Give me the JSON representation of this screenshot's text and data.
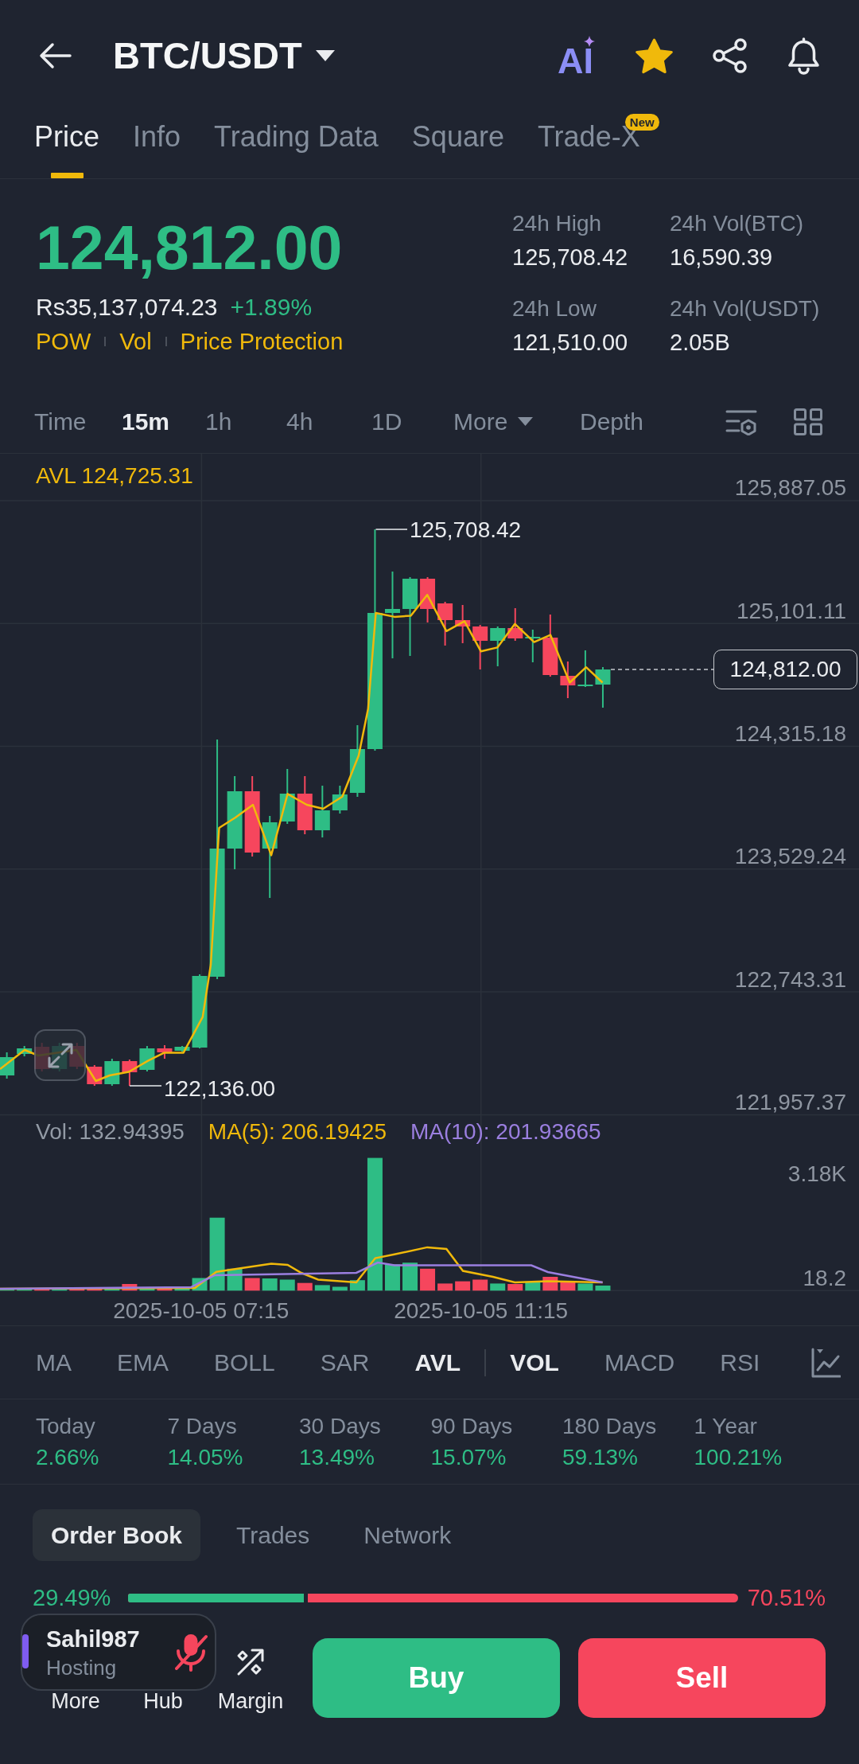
{
  "header": {
    "pair": "BTC/USDT",
    "ai_label": "AI",
    "favorite": true
  },
  "tabs": [
    {
      "label": "Price",
      "selected": true
    },
    {
      "label": "Info",
      "selected": false
    },
    {
      "label": "Trading Data",
      "selected": false
    },
    {
      "label": "Square",
      "selected": false
    },
    {
      "label": "Trade-X",
      "selected": false,
      "badge": "New"
    }
  ],
  "ticker": {
    "last_price": "124,812.00",
    "local_price": "Rs35,137,074.23",
    "change": "+1.89%",
    "tags": [
      "POW",
      "Vol",
      "Price Protection"
    ]
  },
  "stats": [
    {
      "label": "24h High",
      "value": "125,708.42"
    },
    {
      "label": "24h Vol(BTC)",
      "value": "16,590.39"
    },
    {
      "label": "24h Low",
      "value": "121,510.00"
    },
    {
      "label": "24h Vol(USDT)",
      "value": "2.05B"
    }
  ],
  "intervals": [
    {
      "label": "Time",
      "kind": "option",
      "selected": false
    },
    {
      "label": "15m",
      "kind": "option",
      "selected": true
    },
    {
      "label": "1h",
      "kind": "option",
      "selected": false
    },
    {
      "label": "4h",
      "kind": "option",
      "selected": false
    },
    {
      "label": "1D",
      "kind": "option",
      "selected": false
    },
    {
      "label": "More",
      "kind": "dropdown",
      "selected": false
    },
    {
      "label": "Depth",
      "kind": "option",
      "selected": false
    }
  ],
  "chart": {
    "indicator_reading": "AVL 124,725.31",
    "price_axis": [
      "125,887.05",
      "125,101.11",
      "124,315.18",
      "123,529.24",
      "122,743.31",
      "121,957.37"
    ],
    "high_marker": "125,708.42",
    "low_marker": "122,136.00",
    "last_price_tag": "124,812.00"
  },
  "volume": {
    "legend": [
      {
        "text": "Vol: 132.94395",
        "color": "#929aa5"
      },
      {
        "text": "MA(5): 206.19425",
        "color": "#f0b90b"
      },
      {
        "text": "MA(10): 201.93665",
        "color": "#9b7fe0"
      }
    ],
    "axis": [
      "3.18K",
      "18.2"
    ]
  },
  "time_axis": [
    "2025-10-05 07:15",
    "2025-10-05 11:15"
  ],
  "indicators": {
    "main": [
      {
        "label": "MA",
        "selected": false
      },
      {
        "label": "EMA",
        "selected": false
      },
      {
        "label": "BOLL",
        "selected": false
      },
      {
        "label": "SAR",
        "selected": false
      },
      {
        "label": "AVL",
        "selected": true
      }
    ],
    "sub": [
      {
        "label": "VOL",
        "selected": true
      },
      {
        "label": "MACD",
        "selected": false
      },
      {
        "label": "RSI",
        "selected": false
      }
    ]
  },
  "performance": [
    {
      "label": "Today",
      "value": "2.66%"
    },
    {
      "label": "7 Days",
      "value": "14.05%"
    },
    {
      "label": "30 Days",
      "value": "13.49%"
    },
    {
      "label": "90 Days",
      "value": "15.07%"
    },
    {
      "label": "180 Days",
      "value": "59.13%"
    },
    {
      "label": "1 Year",
      "value": "100.21%"
    }
  ],
  "book_tabs": [
    {
      "label": "Order Book",
      "selected": true
    },
    {
      "label": "Trades",
      "selected": false
    },
    {
      "label": "Network",
      "selected": false
    }
  ],
  "ratio": {
    "buy_label": "29.49%",
    "sell_label": "70.51%",
    "level": 0.2949
  },
  "bottom_nav": [
    {
      "label": "More",
      "kind": "more"
    },
    {
      "label": "Hub",
      "kind": "hub"
    },
    {
      "label": "Margin",
      "kind": "margin"
    }
  ],
  "actions": [
    {
      "label": "Buy",
      "kind": "buy"
    },
    {
      "label": "Sell",
      "kind": "sell"
    }
  ],
  "live_overlay": {
    "name": "Sahil987",
    "status": "Hosting",
    "muted": true
  }
}
